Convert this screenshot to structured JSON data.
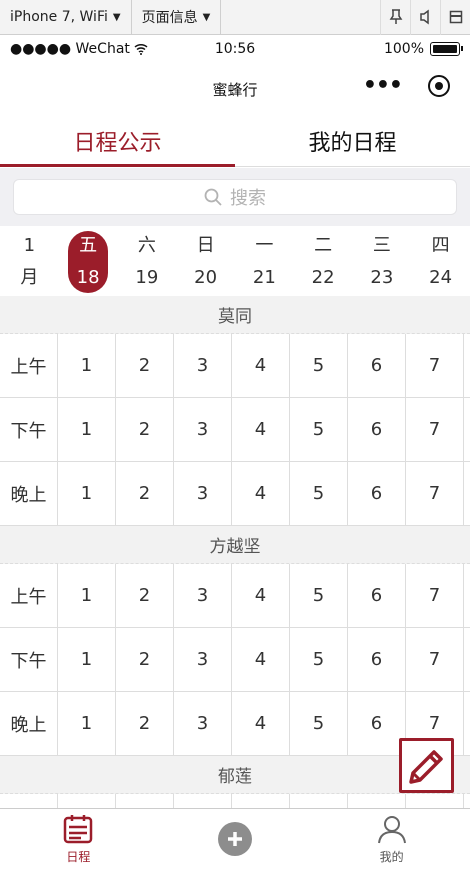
{
  "devtools": {
    "device_label": "iPhone 7, WiFi",
    "page_info_label": "页面信息"
  },
  "status_bar": {
    "carrier": "●●●●● WeChat",
    "time": "10:56",
    "battery": "100%"
  },
  "navbar": {
    "title": "蜜蜂行"
  },
  "tabs": [
    {
      "label": "日程公示",
      "active": true
    },
    {
      "label": "我的日程",
      "active": false
    }
  ],
  "search": {
    "placeholder": "搜索"
  },
  "week": {
    "month_top": "1",
    "month_bottom": "月",
    "days": [
      {
        "weekday": "五",
        "date": "18",
        "active": true
      },
      {
        "weekday": "六",
        "date": "19",
        "active": false
      },
      {
        "weekday": "日",
        "date": "20",
        "active": false
      },
      {
        "weekday": "一",
        "date": "21",
        "active": false
      },
      {
        "weekday": "二",
        "date": "22",
        "active": false
      },
      {
        "weekday": "三",
        "date": "23",
        "active": false
      },
      {
        "weekday": "四",
        "date": "24",
        "active": false
      }
    ]
  },
  "schedule": {
    "slots": [
      "上午",
      "下午",
      "晚上"
    ],
    "values": [
      "1",
      "2",
      "3",
      "4",
      "5",
      "6",
      "7"
    ],
    "people": [
      {
        "name": "莫同"
      },
      {
        "name": "方越坚"
      },
      {
        "name": "郁莲"
      }
    ]
  },
  "tabbar": {
    "items": [
      {
        "label": "日程",
        "active": true
      },
      {
        "label": "",
        "active": false
      },
      {
        "label": "我的",
        "active": false
      }
    ]
  },
  "colors": {
    "accent": "#9b1d2a"
  }
}
